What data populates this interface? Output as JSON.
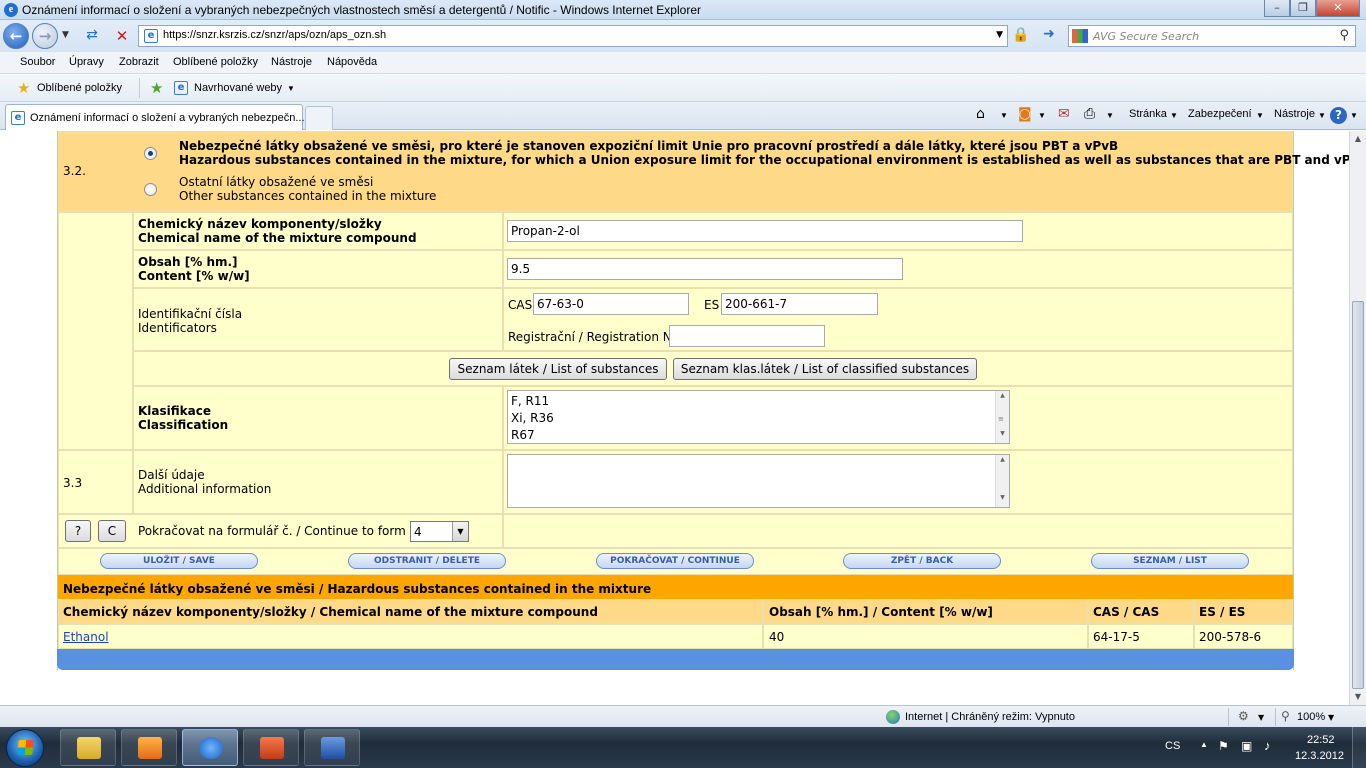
{
  "window": {
    "title": "Oznámení informací o složení a vybraných nebezpečných vlastnostech směsí a detergentů / Notific - Windows Internet Explorer"
  },
  "address": {
    "url": "https://snzr.ksrzis.cz/snzr/aps/ozn/aps_ozn.sh",
    "search_placeholder": "AVG Secure Search"
  },
  "menu": [
    "Soubor",
    "Úpravy",
    "Zobrazit",
    "Oblíbené položky",
    "Nástroje",
    "Nápověda"
  ],
  "favorites": {
    "favorites_label": "Oblíbené položky",
    "suggested_label": "Navrhované weby"
  },
  "tab": {
    "label": "Oznámení informací o složení a vybraných nebezpečn..."
  },
  "commandbar": {
    "page": "Stránka",
    "safety": "Zabezpečení",
    "tools": "Nástroje"
  },
  "form": {
    "section_num": "3.2.",
    "option1_cs": "Nebezpečné látky obsažené ve směsi, pro které je stanoven expoziční limit Unie pro pracovní prostředí a dále látky, které jsou PBT a vPvB",
    "option1_en": "Hazardous substances contained in the mixture, for which a Union exposure limit for the occupational environment is established as well as substances that are PBT and vPvB",
    "option2_cs": "Ostatní látky obsažené ve směsi",
    "option2_en": "Other substances contained in the mixture",
    "chem_name_label_cs": "Chemický název komponenty/složky",
    "chem_name_label_en": "Chemical name of the mixture compound",
    "chem_name_value": "Propan-2-ol",
    "content_label_cs": "Obsah [% hm.]",
    "content_label_en": "Content [% w/w]",
    "content_value": "9.5",
    "ident_label_cs": "Identifikační čísla",
    "ident_label_en": "Identificators",
    "cas_label": "CAS",
    "cas_value": "67-63-0",
    "es_label": "ES",
    "es_value": "200-661-7",
    "reg_label": "Registrační / Registration No.",
    "reg_value": "",
    "btn_substances": "Seznam látek / List of substances",
    "btn_classified": "Seznam klas.látek / List of classified substances",
    "class_label_cs": "Klasifikace",
    "class_label_en": "Classification",
    "classification": [
      "F, R11",
      "Xi, R36",
      "R67"
    ],
    "section_33": "3.3",
    "addinfo_label_cs": "Další údaje",
    "addinfo_label_en": "Additional information",
    "addinfo_value": "",
    "help_btn": "?",
    "c_btn": "C",
    "continue_label": "Pokračovat na formulář č. / Continue to form No.",
    "continue_value": "4"
  },
  "actions": {
    "save": "ULOŽIT / SAVE",
    "delete": "ODSTRANIT / DELETE",
    "continue": "POKRAČOVAT / CONTINUE",
    "back": "ZPĚT / BACK",
    "list": "SEZNAM / LIST"
  },
  "table": {
    "title": "Nebezpečné látky obsažené ve směsi / Hazardous substances contained in the mixture",
    "headers": [
      "Chemický název komponenty/složky / Chemical name of the mixture compound",
      "Obsah [% hm.] / Content [% w/w]",
      "CAS / CAS",
      "ES / ES"
    ],
    "rows": [
      [
        "Ethanol",
        "40",
        "64-17-5",
        "200-578-6"
      ]
    ]
  },
  "status": {
    "zone": "Internet | Chráněný režim: Vypnuto",
    "zoom": "100%"
  },
  "taskbar": {
    "lang": "CS",
    "time": "22:52",
    "date": "12.3.2012"
  },
  "colors": {
    "form_bg": "#ffffcc",
    "selected_bg": "#fdd988",
    "table_title_bg": "#ffa500",
    "footer_blue": "#5b8fe0"
  }
}
